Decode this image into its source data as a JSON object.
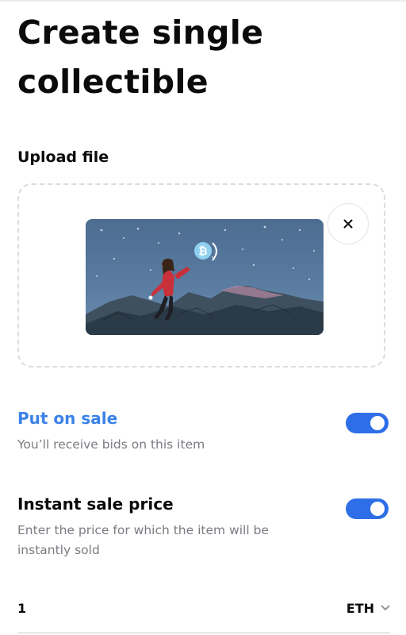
{
  "page": {
    "title": "Create single collectible"
  },
  "upload": {
    "label": "Upload file",
    "preview_image": "collectible-artwork-preview",
    "remove_icon": "close-icon"
  },
  "put_on_sale": {
    "title": "Put on sale",
    "description": "You’ll receive bids on this item",
    "enabled": true
  },
  "instant_sale_price": {
    "title": "Instant sale price",
    "description": "Enter the price for which the item will be instantly sold",
    "enabled": true,
    "value": "1",
    "currency": "ETH",
    "currency_icon": "chevron-down-icon"
  },
  "colors": {
    "accent_text": "#3b82e8",
    "toggle_on": "#2e6fe8",
    "muted_text": "#7b7b82",
    "dashed_border": "#dcdce0"
  }
}
